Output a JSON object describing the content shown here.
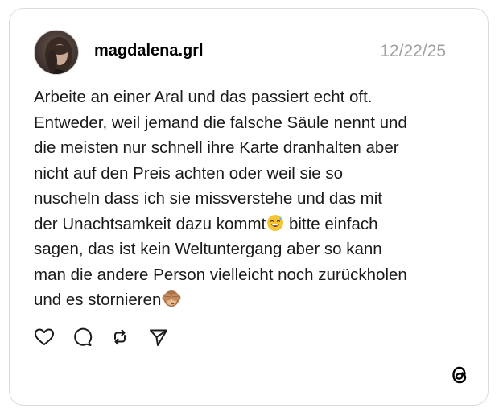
{
  "post": {
    "username": "magdalena.grl",
    "date": "12/22/25",
    "avatar_icon": "user-avatar-photo",
    "text_lines": [
      "Arbeite an einer Aral und das passiert echt oft.",
      "Entweder, weil jemand die falsche Säule nennt und",
      "die meisten nur schnell ihre Karte dranhalten aber",
      "nicht auf den Preis achten oder weil sie so",
      "nuscheln dass ich sie missverstehe und das mit",
      "der Unachtsamkeit dazu kommt",
      "😅",
      " bitte einfach",
      "sagen, das ist kein Weltuntergang aber so kann",
      "man die andere Person vielleicht noch zurückholen",
      "und es stornieren",
      "🙈"
    ]
  },
  "actions": {
    "like_icon": "heart-icon",
    "reply_icon": "comment-bubble-icon",
    "repost_icon": "repost-arrows-icon",
    "share_icon": "send-paper-plane-icon"
  },
  "brand": {
    "logo_icon": "threads-logo-icon"
  },
  "colors": {
    "text": "#1a1a1a",
    "muted": "#a0a0a0",
    "border": "#dcdcdc"
  }
}
